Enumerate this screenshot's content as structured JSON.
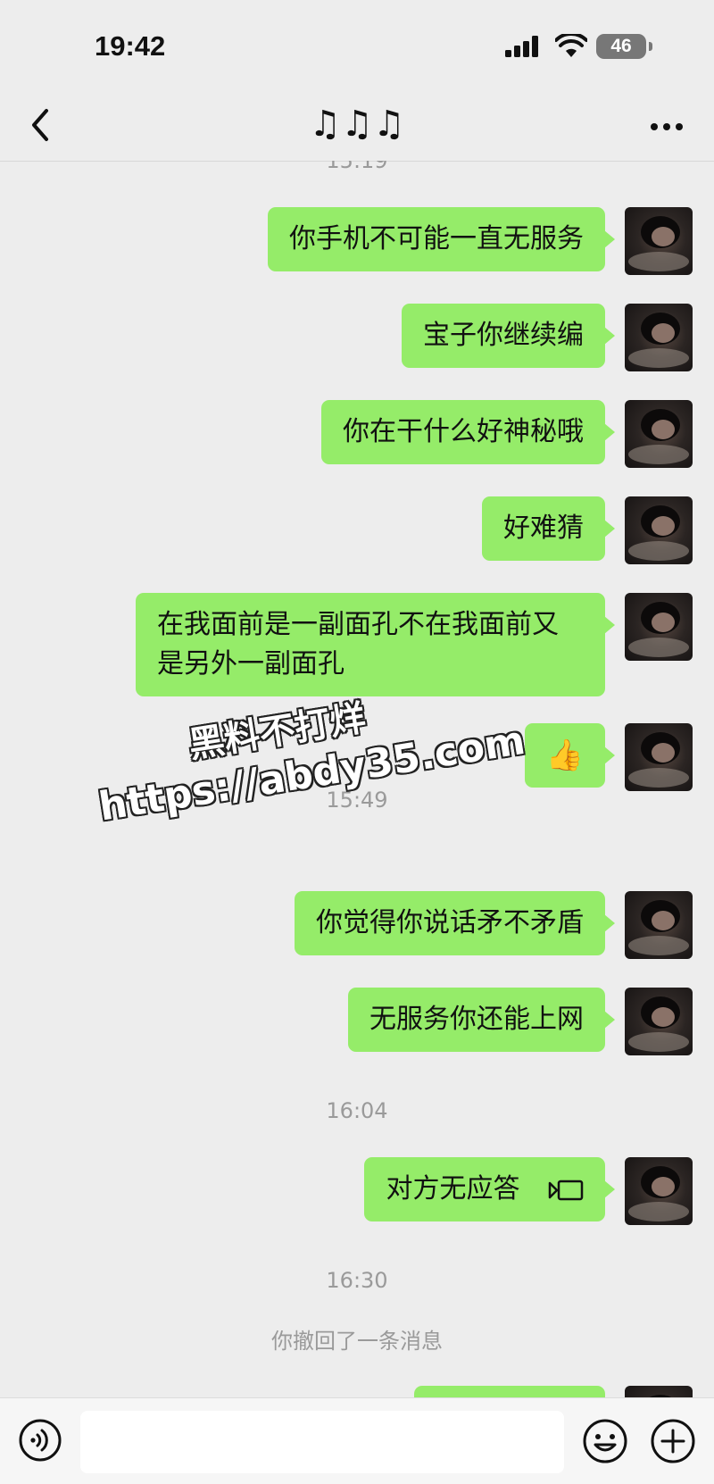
{
  "status": {
    "time": "19:42",
    "battery": "46"
  },
  "header": {
    "title": "♫♫♫"
  },
  "chat": {
    "top_time_partial": "15:19",
    "messages_1": [
      {
        "text": "你手机不可能一直无服务"
      },
      {
        "text": "宝子你继续编"
      },
      {
        "text": "你在干什么好神秘哦"
      },
      {
        "text": "好难猜"
      },
      {
        "text": "在我面前是一副面孔不在我面前又是另外一副面孔"
      },
      {
        "text": "👍"
      }
    ],
    "time_2": "15:49",
    "messages_2": [
      {
        "text": "你觉得你说话矛不矛盾"
      },
      {
        "text": "无服务你还能上网"
      }
    ],
    "time_3": "16:04",
    "call_message": {
      "text": "对方无应答",
      "icon": "video-call-icon"
    },
    "time_4": "16:30",
    "recall_note": "你撤回了一条消息"
  },
  "watermark": {
    "line1": "黑料不打烊",
    "line2": "https://abdy35.com"
  },
  "input_bar": {
    "placeholder": "",
    "icons": [
      "voice-icon",
      "emoji-icon",
      "plus-icon"
    ]
  },
  "colors": {
    "bubble": "#95ec69",
    "background": "#ededed",
    "muted_text": "#9a9a9a"
  }
}
